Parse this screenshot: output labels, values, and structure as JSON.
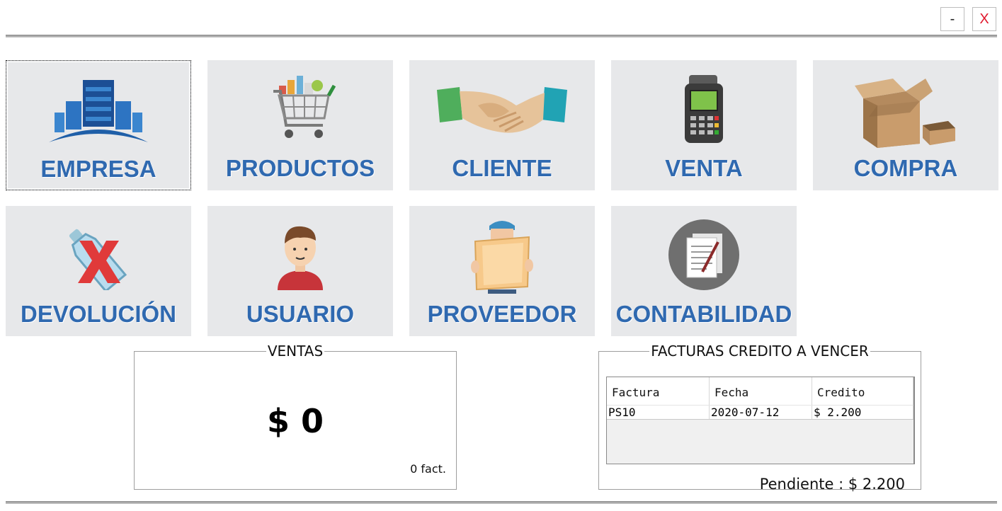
{
  "window": {
    "minimize_label": "-",
    "close_label": "X"
  },
  "tiles": [
    {
      "label": "EMPRESA",
      "icon": "building-icon"
    },
    {
      "label": "PRODUCTOS",
      "icon": "shopping-cart-icon"
    },
    {
      "label": "CLIENTE",
      "icon": "handshake-icon"
    },
    {
      "label": "VENTA",
      "icon": "card-terminal-icon"
    },
    {
      "label": "COMPRA",
      "icon": "open-box-icon"
    },
    {
      "label": "DEVOLUCIÓN",
      "icon": "return-bottle-icon"
    },
    {
      "label": "USUARIO",
      "icon": "user-icon"
    },
    {
      "label": "PROVEEDOR",
      "icon": "supplier-icon"
    },
    {
      "label": "CONTABILIDAD",
      "icon": "document-icon"
    }
  ],
  "ventas": {
    "title": "VENTAS",
    "amount": "$ 0",
    "count": "0 fact."
  },
  "facturas": {
    "title": "FACTURAS CREDITO A VENCER",
    "columns": [
      "Factura",
      "Fecha",
      "Credito"
    ],
    "rows": [
      [
        "PS10",
        "2020-07-12",
        "$ 2.200"
      ]
    ],
    "pending": "Pendiente : $ 2.200"
  },
  "colors": {
    "tile_bg": "#e7e8ea",
    "label_blue": "#2f69b0",
    "close_red": "#e0182d"
  }
}
